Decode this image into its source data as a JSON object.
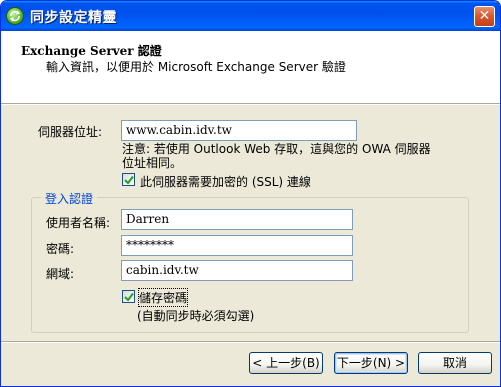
{
  "window": {
    "title": "同步設定精靈",
    "close_glyph": "✕"
  },
  "header": {
    "title": "Exchange Server 認證",
    "subtitle": "輸入資訊，以便用於 Microsoft Exchange Server 驗證"
  },
  "server": {
    "label": "伺服器位址:",
    "value": "www.cabin.idv.tw",
    "note": "注意: 若使用 Outlook Web 存取，這與您的 OWA 伺服器位址相同。",
    "ssl_label": "此伺服器需要加密的 (SSL) 連線",
    "ssl_checked": true
  },
  "login": {
    "legend": "登入認證",
    "username_label": "使用者名稱:",
    "username_value": "Darren",
    "password_label": "密碼:",
    "password_value": "********",
    "domain_label": "網域:",
    "domain_value": "cabin.idv.tw",
    "save_password_label": "儲存密碼",
    "save_password_checked": true,
    "save_password_hint": "(自動同步時必須勾選)"
  },
  "buttons": {
    "back": "< 上一步(B)",
    "next": "下一步(N) >",
    "cancel": "取消"
  },
  "colors": {
    "titlebar": "#0054e3",
    "dialog_bg": "#ece9d8",
    "group_legend": "#0046d5",
    "textbox_border": "#7f9db9"
  }
}
